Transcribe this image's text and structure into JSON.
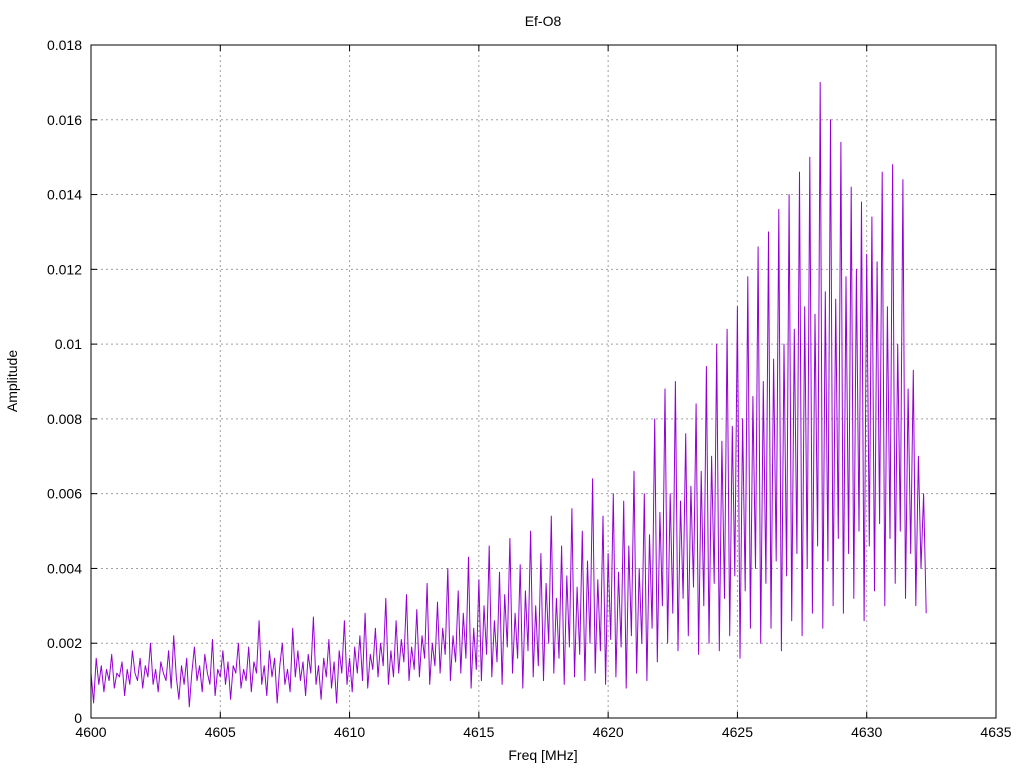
{
  "chart_data": {
    "type": "line",
    "title": "Ef-O8",
    "xlabel": "Freq [MHz]",
    "ylabel": "Amplitude",
    "xlim": [
      4600,
      4635
    ],
    "ylim": [
      0,
      0.018
    ],
    "xticks": [
      "4600",
      "4605",
      "4610",
      "4615",
      "4620",
      "4625",
      "4630",
      "4635"
    ],
    "yticks": [
      "0",
      "0.002",
      "0.004",
      "0.006",
      "0.008",
      "0.01",
      "0.012",
      "0.014",
      "0.016",
      "0.018"
    ],
    "grid": true,
    "legend": "none",
    "series": [
      {
        "color": "#9400d3",
        "x_start": 4600,
        "x_step": 0.1,
        "values": [
          0.0012,
          0.0004,
          0.0016,
          0.0009,
          0.0014,
          0.0007,
          0.0013,
          0.001,
          0.0017,
          0.0008,
          0.0012,
          0.0011,
          0.0015,
          0.0006,
          0.0013,
          0.0009,
          0.0018,
          0.0012,
          0.001,
          0.0016,
          0.0008,
          0.0014,
          0.0011,
          0.002,
          0.0009,
          0.0013,
          0.0007,
          0.0015,
          0.0012,
          0.001,
          0.0018,
          0.0008,
          0.0022,
          0.0011,
          0.0005,
          0.0014,
          0.0009,
          0.0016,
          0.0003,
          0.0012,
          0.0019,
          0.001,
          0.0014,
          0.0007,
          0.0017,
          0.0012,
          0.0009,
          0.0021,
          0.0006,
          0.0013,
          0.0011,
          0.0018,
          0.0009,
          0.0015,
          0.0005,
          0.0014,
          0.0012,
          0.002,
          0.0008,
          0.0013,
          0.001,
          0.0019,
          0.0007,
          0.0015,
          0.0012,
          0.0026,
          0.0009,
          0.0014,
          0.0006,
          0.0018,
          0.0011,
          0.0016,
          0.0004,
          0.0014,
          0.002,
          0.0009,
          0.0013,
          0.0007,
          0.0024,
          0.0011,
          0.0018,
          0.001,
          0.0015,
          0.0006,
          0.0017,
          0.0012,
          0.0027,
          0.0009,
          0.0014,
          0.0005,
          0.0016,
          0.0011,
          0.0021,
          0.0008,
          0.0015,
          0.0004,
          0.0018,
          0.0012,
          0.0026,
          0.0009,
          0.0016,
          0.0007,
          0.0019,
          0.0012,
          0.0022,
          0.001,
          0.0028,
          0.0008,
          0.0017,
          0.0013,
          0.0024,
          0.0011,
          0.002,
          0.0014,
          0.0032,
          0.0009,
          0.0018,
          0.0011,
          0.0026,
          0.0012,
          0.0021,
          0.0015,
          0.0033,
          0.001,
          0.0019,
          0.0013,
          0.0029,
          0.0011,
          0.0022,
          0.0016,
          0.0036,
          0.0009,
          0.002,
          0.0014,
          0.0031,
          0.0012,
          0.0024,
          0.0017,
          0.004,
          0.001,
          0.0022,
          0.0015,
          0.0034,
          0.0012,
          0.0028,
          0.0016,
          0.0043,
          0.0008,
          0.0024,
          0.0013,
          0.0037,
          0.001,
          0.003,
          0.0017,
          0.0046,
          0.0011,
          0.0026,
          0.0015,
          0.0039,
          0.0009,
          0.0033,
          0.0019,
          0.0048,
          0.0012,
          0.0028,
          0.0016,
          0.0041,
          0.0008,
          0.0034,
          0.0018,
          0.005,
          0.0011,
          0.003,
          0.0014,
          0.0044,
          0.001,
          0.0036,
          0.002,
          0.0054,
          0.0012,
          0.0032,
          0.0016,
          0.0046,
          0.0009,
          0.0038,
          0.0019,
          0.0056,
          0.0011,
          0.0035,
          0.0017,
          0.005,
          0.001,
          0.0042,
          0.002,
          0.0064,
          0.0012,
          0.0037,
          0.0018,
          0.0054,
          0.0009,
          0.0044,
          0.0021,
          0.006,
          0.0011,
          0.0039,
          0.0019,
          0.0058,
          0.0008,
          0.0046,
          0.0022,
          0.0066,
          0.0012,
          0.004,
          0.002,
          0.006,
          0.001,
          0.0049,
          0.0024,
          0.008,
          0.0015,
          0.0055,
          0.003,
          0.0088,
          0.002,
          0.006,
          0.0028,
          0.009,
          0.0018,
          0.0058,
          0.0032,
          0.0076,
          0.0022,
          0.0062,
          0.0035,
          0.0084,
          0.0017,
          0.0066,
          0.003,
          0.0094,
          0.002,
          0.007,
          0.0036,
          0.01,
          0.0018,
          0.0074,
          0.0032,
          0.0104,
          0.0022,
          0.0078,
          0.0038,
          0.011,
          0.0016,
          0.008,
          0.0034,
          0.0118,
          0.0024,
          0.0086,
          0.004,
          0.0126,
          0.002,
          0.009,
          0.0036,
          0.013,
          0.0024,
          0.0096,
          0.0042,
          0.0136,
          0.0018,
          0.01,
          0.0038,
          0.014,
          0.0026,
          0.0104,
          0.0044,
          0.0146,
          0.0022,
          0.011,
          0.004,
          0.015,
          0.0028,
          0.0108,
          0.0046,
          0.017,
          0.0024,
          0.0114,
          0.0042,
          0.016,
          0.003,
          0.0112,
          0.0048,
          0.0154,
          0.0028,
          0.0118,
          0.0044,
          0.0142,
          0.0032,
          0.012,
          0.005,
          0.0138,
          0.0026,
          0.0124,
          0.0046,
          0.0134,
          0.0034,
          0.0122,
          0.0052,
          0.0146,
          0.003,
          0.011,
          0.0048,
          0.0148,
          0.0036,
          0.01,
          0.005,
          0.0144,
          0.0032,
          0.0088,
          0.0044,
          0.0093,
          0.003,
          0.007,
          0.004,
          0.006,
          0.0028
        ]
      }
    ]
  }
}
